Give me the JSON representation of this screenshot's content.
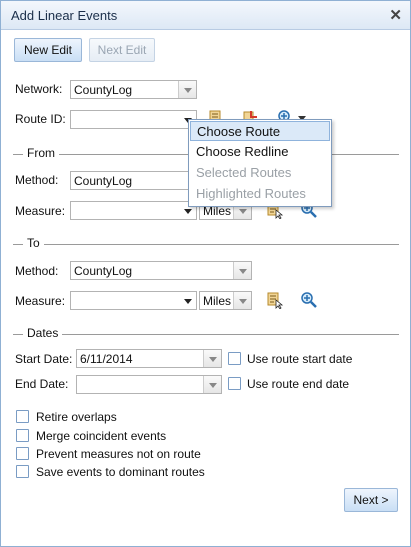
{
  "window": {
    "title": "Add Linear Events"
  },
  "toolbar": {
    "new_edit": "New Edit",
    "next_edit": "Next Edit"
  },
  "network": {
    "label": "Network:",
    "value": "CountyLog"
  },
  "route": {
    "label": "Route ID:",
    "value": ""
  },
  "from": {
    "title": "From",
    "method_label": "Method:",
    "method_value": "CountyLog",
    "measure_label": "Measure:",
    "measure_value": "",
    "units": "Miles"
  },
  "to": {
    "title": "To",
    "method_label": "Method:",
    "method_value": "CountyLog",
    "measure_label": "Measure:",
    "measure_value": "",
    "units": "Miles"
  },
  "dates": {
    "title": "Dates",
    "start_label": "Start Date:",
    "start_value": "6/11/2014",
    "use_start": "Use route start date",
    "end_label": "End Date:",
    "end_value": "",
    "use_end": "Use route end date"
  },
  "options": {
    "retire": "Retire overlaps",
    "merge": "Merge coincident events",
    "prevent": "Prevent measures not on route",
    "save": "Save events to dominant routes"
  },
  "next_button": "Next >",
  "menu": {
    "items": [
      "Choose Route",
      "Choose Redline",
      "Selected Routes",
      "Highlighted Routes"
    ]
  }
}
